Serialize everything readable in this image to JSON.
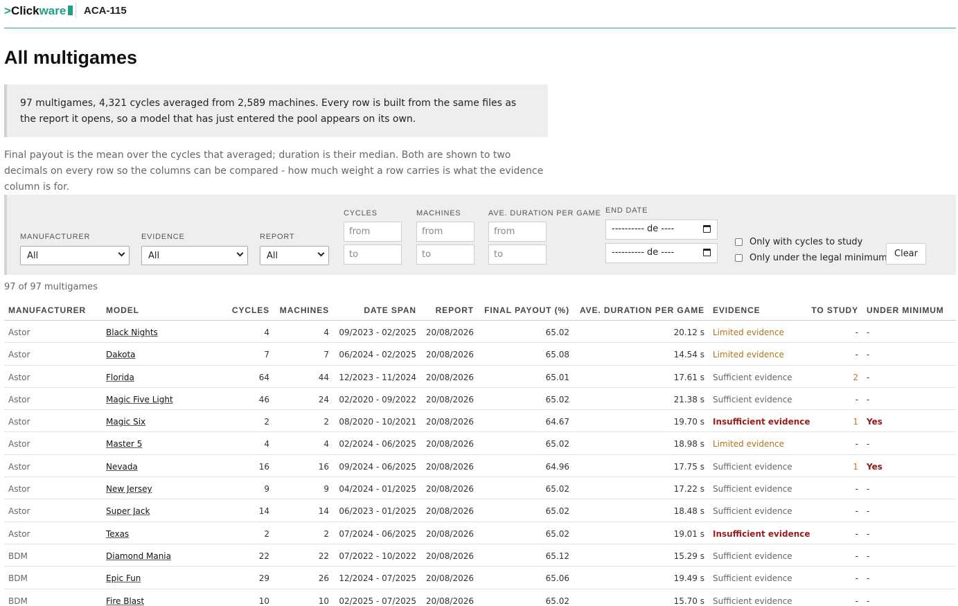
{
  "header": {
    "logo_prefix": ">",
    "logo_click": "Click",
    "logo_ware": "ware",
    "app_code": "ACA-115"
  },
  "page_title": "All multigames",
  "summary": "97 multigames, 4,321 cycles averaged from 2,589 machines. Every row is built from the same files as the report it opens, so a model that has just entered the pool appears on its own.",
  "note": "Final payout is the mean over the cycles that averaged; duration is their median. Both are shown to two decimals on every row so the columns can be compared - how much weight a row carries is what the evidence column is for.",
  "filters": {
    "manufacturer_label": "Manufacturer",
    "manufacturer_value": "All",
    "evidence_label": "Evidence",
    "evidence_value": "All",
    "report_label": "Report",
    "report_value": "All",
    "cycles_label": "Cycles",
    "machines_label": "Machines",
    "duration_label": "Ave. duration per game",
    "end_date_label": "End date",
    "from_placeholder": "from",
    "to_placeholder": "to",
    "date_placeholder": "---------- de ----",
    "only_cycles_label": "Only with cycles to study",
    "only_legal_label": "Only under the legal minimum",
    "clear_label": "Clear"
  },
  "count_text": "97 of 97 multigames",
  "table": {
    "headers": {
      "manufacturer": "Manufacturer",
      "model": "Model",
      "cycles": "Cycles",
      "machines": "Machines",
      "date_span": "Date span",
      "report": "Report",
      "final_payout": "Final payout (%)",
      "duration": "Ave. duration per game",
      "evidence": "Evidence",
      "to_study": "To study",
      "under_minimum": "Under minimum"
    },
    "rows": [
      {
        "manufacturer": "Astor",
        "model": "Black Nights",
        "cycles": "4",
        "machines": "4",
        "date_span": "09/2023 - 02/2025",
        "report": "20/08/2026",
        "payout": "65.02",
        "duration": "20.12 s",
        "evidence": "Limited evidence",
        "evidence_level": "limited",
        "to_study": "-",
        "under_min": "-"
      },
      {
        "manufacturer": "Astor",
        "model": "Dakota",
        "cycles": "7",
        "machines": "7",
        "date_span": "06/2024 - 02/2025",
        "report": "20/08/2026",
        "payout": "65.08",
        "duration": "14.54 s",
        "evidence": "Limited evidence",
        "evidence_level": "limited",
        "to_study": "-",
        "under_min": "-"
      },
      {
        "manufacturer": "Astor",
        "model": "Florida",
        "cycles": "64",
        "machines": "44",
        "date_span": "12/2023 - 11/2024",
        "report": "20/08/2026",
        "payout": "65.01",
        "duration": "17.61 s",
        "evidence": "Sufficient evidence",
        "evidence_level": "sufficient",
        "to_study": "2",
        "under_min": "-"
      },
      {
        "manufacturer": "Astor",
        "model": "Magic Five Light",
        "cycles": "46",
        "machines": "24",
        "date_span": "02/2020 - 09/2022",
        "report": "20/08/2026",
        "payout": "65.02",
        "duration": "21.38 s",
        "evidence": "Sufficient evidence",
        "evidence_level": "sufficient",
        "to_study": "-",
        "under_min": "-"
      },
      {
        "manufacturer": "Astor",
        "model": "Magic Six",
        "cycles": "2",
        "machines": "2",
        "date_span": "08/2020 - 10/2021",
        "report": "20/08/2026",
        "payout": "64.67",
        "duration": "19.70 s",
        "evidence": "Insufficient evidence",
        "evidence_level": "insufficient",
        "to_study": "1",
        "under_min": "Yes"
      },
      {
        "manufacturer": "Astor",
        "model": "Master 5",
        "cycles": "4",
        "machines": "4",
        "date_span": "02/2024 - 06/2025",
        "report": "20/08/2026",
        "payout": "65.02",
        "duration": "18.98 s",
        "evidence": "Limited evidence",
        "evidence_level": "limited",
        "to_study": "-",
        "under_min": "-"
      },
      {
        "manufacturer": "Astor",
        "model": "Nevada",
        "cycles": "16",
        "machines": "16",
        "date_span": "09/2024 - 06/2025",
        "report": "20/08/2026",
        "payout": "64.96",
        "duration": "17.75 s",
        "evidence": "Sufficient evidence",
        "evidence_level": "sufficient",
        "to_study": "1",
        "under_min": "Yes"
      },
      {
        "manufacturer": "Astor",
        "model": "New Jersey",
        "cycles": "9",
        "machines": "9",
        "date_span": "04/2024 - 01/2025",
        "report": "20/08/2026",
        "payout": "65.02",
        "duration": "17.22 s",
        "evidence": "Sufficient evidence",
        "evidence_level": "sufficient",
        "to_study": "-",
        "under_min": "-"
      },
      {
        "manufacturer": "Astor",
        "model": "Super Jack",
        "cycles": "14",
        "machines": "14",
        "date_span": "06/2023 - 01/2025",
        "report": "20/08/2026",
        "payout": "65.02",
        "duration": "18.48 s",
        "evidence": "Sufficient evidence",
        "evidence_level": "sufficient",
        "to_study": "-",
        "under_min": "-"
      },
      {
        "manufacturer": "Astor",
        "model": "Texas",
        "cycles": "2",
        "machines": "2",
        "date_span": "07/2024 - 06/2025",
        "report": "20/08/2026",
        "payout": "65.02",
        "duration": "19.01 s",
        "evidence": "Insufficient evidence",
        "evidence_level": "insufficient",
        "to_study": "-",
        "under_min": "-"
      },
      {
        "manufacturer": "BDM",
        "model": "Diamond Mania",
        "cycles": "22",
        "machines": "22",
        "date_span": "07/2022 - 10/2022",
        "report": "20/08/2026",
        "payout": "65.12",
        "duration": "15.29 s",
        "evidence": "Sufficient evidence",
        "evidence_level": "sufficient",
        "to_study": "-",
        "under_min": "-"
      },
      {
        "manufacturer": "BDM",
        "model": "Epic Fun",
        "cycles": "29",
        "machines": "26",
        "date_span": "12/2024 - 07/2025",
        "report": "20/08/2026",
        "payout": "65.06",
        "duration": "19.49 s",
        "evidence": "Sufficient evidence",
        "evidence_level": "sufficient",
        "to_study": "-",
        "under_min": "-"
      },
      {
        "manufacturer": "BDM",
        "model": "Fire Blast",
        "cycles": "10",
        "machines": "10",
        "date_span": "02/2025 - 07/2025",
        "report": "20/08/2026",
        "payout": "65.02",
        "duration": "15.70 s",
        "evidence": "Sufficient evidence",
        "evidence_level": "sufficient",
        "to_study": "-",
        "under_min": "-"
      }
    ]
  }
}
